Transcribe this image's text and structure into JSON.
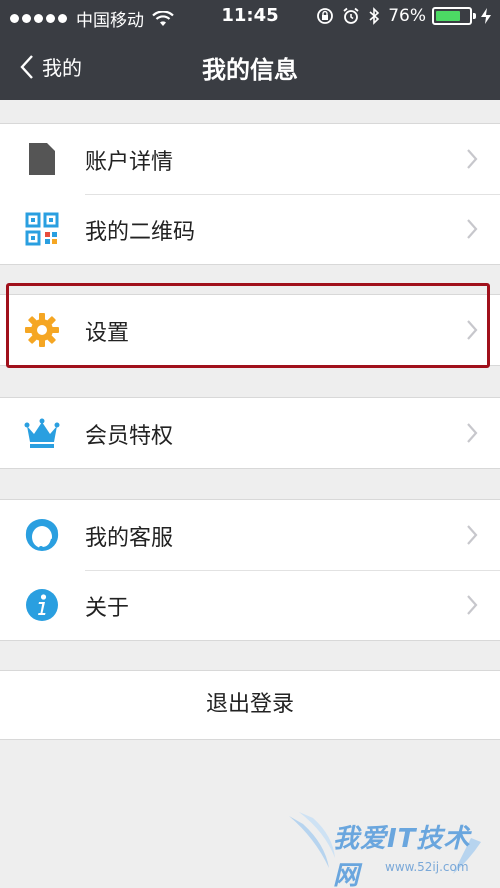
{
  "status_bar": {
    "carrier": "中国移动",
    "time": "11:45",
    "battery": "76%",
    "battery_level": 0.76
  },
  "nav": {
    "back_label": "我的",
    "title": "我的信息"
  },
  "groups": [
    {
      "items": [
        {
          "label": "账户详情",
          "icon": "account-avatar-icon"
        },
        {
          "label": "我的二维码",
          "icon": "qr-code-icon"
        }
      ]
    },
    {
      "items": [
        {
          "label": "设置",
          "icon": "gear-icon"
        }
      ]
    },
    {
      "items": [
        {
          "label": "会员特权",
          "icon": "crown-icon"
        }
      ]
    },
    {
      "items": [
        {
          "label": "我的客服",
          "icon": "customer-service-icon"
        },
        {
          "label": "关于",
          "icon": "info-icon"
        }
      ]
    }
  ],
  "logout_label": "退出登录",
  "watermark": {
    "text": "我爱IT技术网",
    "url": "www.52ij.com"
  },
  "colors": {
    "header_bg": "#3a3d43",
    "page_bg": "#eeeeee",
    "highlight_border": "#a0101b",
    "gear": "#f5a623",
    "accent_blue": "#2a9fe0",
    "battery_green": "#4cd964"
  }
}
